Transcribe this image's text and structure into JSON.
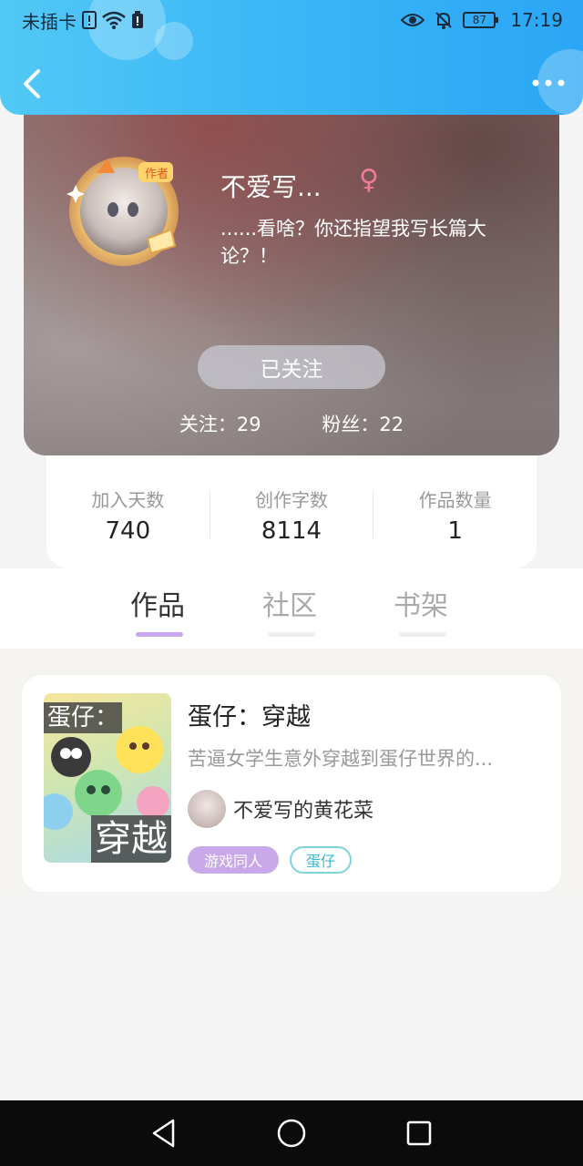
{
  "status_bar": {
    "carrier": "未插卡",
    "battery": "87",
    "time": "17:19"
  },
  "profile": {
    "name": "不爱写...",
    "gender_symbol": "♀",
    "bio": "......看啥？你还指望我写长篇大论？！",
    "badge": "作者",
    "follow_button": "已关注",
    "following_label": "关注：29",
    "fans_label": "粉丝：22"
  },
  "stats": [
    {
      "label": "加入天数",
      "value": "740"
    },
    {
      "label": "创作字数",
      "value": "8114"
    },
    {
      "label": "作品数量",
      "value": "1"
    }
  ],
  "tabs": [
    {
      "label": "作品",
      "active": true
    },
    {
      "label": "社区",
      "active": false
    },
    {
      "label": "书架",
      "active": false
    }
  ],
  "works": [
    {
      "cover_top": "蛋仔：",
      "cover_bottom": "穿越",
      "title": "蛋仔：穿越",
      "description": "苦逼女学生意外穿越到蛋仔世界的...",
      "author": "不爱写的黄花菜",
      "tags": [
        "游戏同人",
        "蛋仔"
      ]
    }
  ],
  "colors": {
    "header": "#3ab6f7",
    "tab_active_underline": "#c8a8ec",
    "gender": "#f07aa0",
    "tag_filled": "#c9a8ea",
    "tag_outline": "#7cd2e0"
  }
}
